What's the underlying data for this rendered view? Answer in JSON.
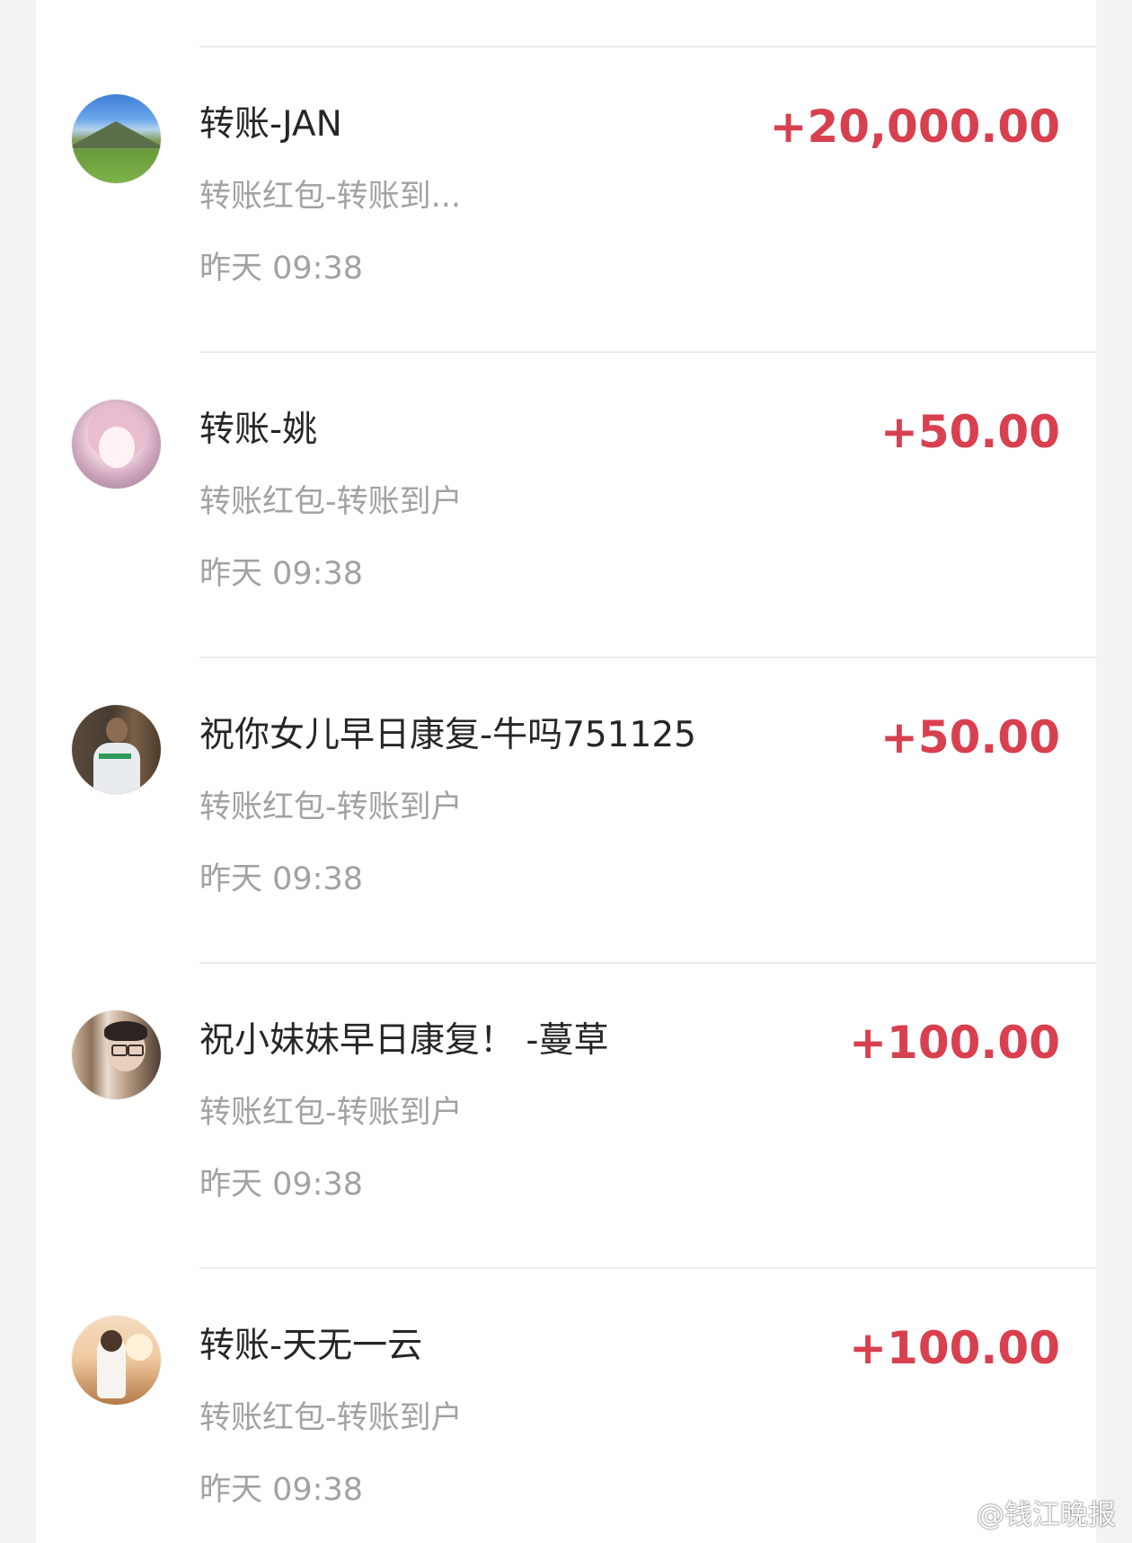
{
  "transactions": [
    {
      "title": "转账-JAN",
      "amount": "+20,000.00",
      "description": "转账红包-转账到...",
      "time": "昨天 09:38",
      "avatar_icon": "landscape-avatar-icon"
    },
    {
      "title": "转账-姚",
      "amount": "+50.00",
      "description": "转账红包-转账到户",
      "time": "昨天 09:38",
      "avatar_icon": "anime-girl-avatar-icon"
    },
    {
      "title": "祝你女儿早日康复-牛吗751125",
      "amount": "+50.00",
      "description": "转账红包-转账到户",
      "time": "昨天 09:38",
      "avatar_icon": "man-photo-avatar-icon"
    },
    {
      "title": "祝小妹妹早日康复！ -蔓草",
      "amount": "+100.00",
      "description": "转账红包-转账到户",
      "time": "昨天 09:38",
      "avatar_icon": "man-glasses-avatar-icon"
    },
    {
      "title": "转账-天无一云",
      "amount": "+100.00",
      "description": "转账红包-转账到户",
      "time": "昨天 09:38",
      "avatar_icon": "girl-sunset-avatar-icon"
    }
  ],
  "watermark": {
    "text": "@钱江晚报",
    "icon": "weibo-logo-icon"
  },
  "colors": {
    "amount": "#d8404f",
    "title": "#262626",
    "secondary_text": "#a2a2a2",
    "divider": "#ececec",
    "background": "#f3f3f3"
  }
}
